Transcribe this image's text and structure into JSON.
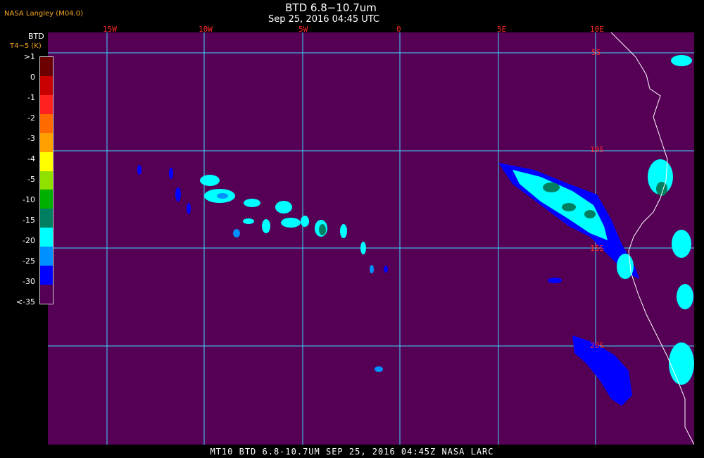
{
  "header": {
    "credit": "NASA Langley (M04.0)",
    "title": "BTD 6.8−10.7um",
    "subtitle": "Sep 25, 2016 04:45 UTC"
  },
  "legend": {
    "title": "BTD",
    "unit": "T4−5 (K)",
    "ticks": [
      ">1",
      "0",
      "-1",
      "-2",
      "-3",
      "-4",
      "-5",
      "-10",
      "-15",
      "-20",
      "-25",
      "-30",
      "<-35"
    ],
    "colors": [
      "#6b0000",
      "#c80000",
      "#ff2020",
      "#ff6a00",
      "#ffa000",
      "#ffff00",
      "#90e000",
      "#00b000",
      "#008060",
      "#00ffff",
      "#0090ff",
      "#0000ff",
      "#550055"
    ]
  },
  "map": {
    "background_color": "#550055",
    "grid_color": "#3fd8ff",
    "coast_color": "#ffffff",
    "longitude_labels": [
      "15W",
      "10W",
      "5W",
      "0",
      "5E",
      "10E"
    ],
    "latitude_labels": [
      "5S",
      "10S",
      "15S",
      "20S"
    ]
  },
  "footer": {
    "text": "MT10  BTD 6.8-10.7UM   SEP 25, 2016 04:45Z   NASA LARC"
  }
}
